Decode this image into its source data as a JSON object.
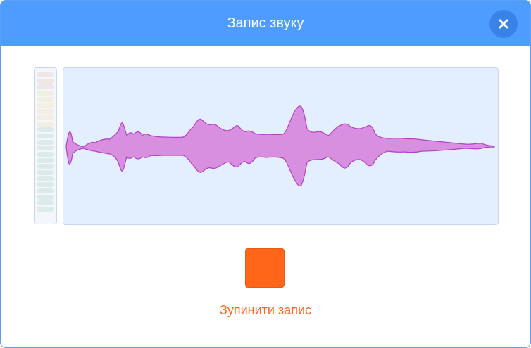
{
  "dialog": {
    "title": "Запис звуку",
    "close_icon": "close-icon"
  },
  "colors": {
    "header": "#4f9cff",
    "close_button": "#3a83e6",
    "waveform_fill": "#d98fe0",
    "waveform_stroke": "#b040c8",
    "waveform_background": "#e3efff",
    "stop_button": "#ff661a",
    "stop_text": "#ff661a",
    "meter_red": "#efe6e6",
    "meter_yellow": "#f3efe0",
    "meter_green": "#dcebe8"
  },
  "level_meter": {
    "segments": [
      "red",
      "red",
      "red",
      "yellow",
      "yellow",
      "yellow",
      "yellow",
      "yellow",
      "yellow",
      "green",
      "green",
      "green",
      "green",
      "green",
      "green",
      "green",
      "green",
      "green",
      "green",
      "green",
      "green",
      "green",
      "green"
    ],
    "active_segments": 0
  },
  "recorder": {
    "stop_label": "Зупинити запис"
  }
}
